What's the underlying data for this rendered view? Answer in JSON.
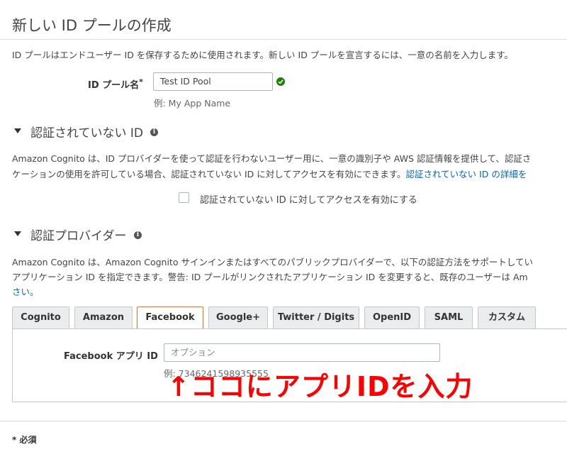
{
  "page_title": "新しい ID プールの作成",
  "intro_text": "ID プールはエンドユーザー ID を保存するために使用されます。新しい ID プールを宣言するには、一意の名前を入力します。",
  "pool_name": {
    "label": "ID プール名",
    "required_mark": "*",
    "value": "Test ID Pool",
    "hint": "例: My App Name"
  },
  "unauth_section": {
    "heading": "認証されていない ID",
    "desc_line1": "Amazon Cognito は、ID プロバイダーを使って認証を行わないユーザー用に、一意の識別子や AWS 認証情報を提供して、認証さ",
    "desc_line2": "ケーションの使用を許可している場合、認証されていない ID に対してアクセスを有効にできます。",
    "desc_link": "認証されていない ID の詳細を",
    "checkbox_label": "認証されていない ID に対してアクセスを有効にする"
  },
  "auth_section": {
    "heading": "認証プロバイダー",
    "desc_line1": "Amazon Cognito は、Amazon Cognito サインインまたはすべてのパブリックプロバイダーで、以下の認証方法をサポートしてい",
    "desc_line2": "アプリケーション ID を指定できます。警告: ID プールがリンクされたアプリケーション ID を変更すると、既存のユーザーは Am",
    "desc_line3": "さい。",
    "tabs": [
      "Cognito",
      "Amazon",
      "Facebook",
      "Google+",
      "Twitter / Digits",
      "OpenID",
      "SAML",
      "カスタム"
    ],
    "active_tab": "Facebook",
    "facebook_app_id": {
      "label": "Facebook アプリ ID",
      "placeholder": "オプション",
      "hint": "例: 7346241598935555"
    }
  },
  "annotation": "↑ココにアプリIDを入力",
  "required_note": "* 必須",
  "colors": {
    "accent_tab_border": "#ec7211",
    "link": "#0066c0",
    "valid_check": "#1d8102",
    "annotation": "#ff0000"
  }
}
